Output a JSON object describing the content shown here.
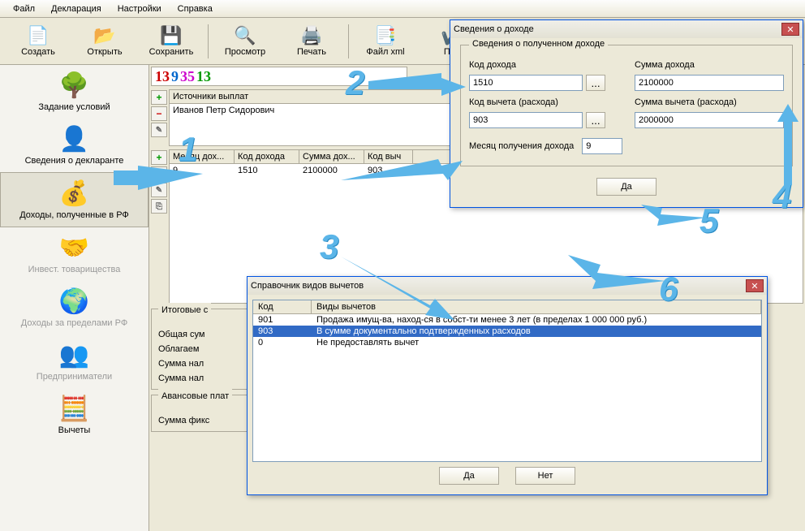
{
  "menubar": {
    "items": [
      "Файл",
      "Декларация",
      "Настройки",
      "Справка"
    ]
  },
  "toolbar": {
    "create": "Создать",
    "open": "Открыть",
    "save": "Сохранить",
    "preview": "Просмотр",
    "print": "Печать",
    "xml": "Файл xml",
    "check": "Про"
  },
  "sidebar": {
    "items": [
      {
        "label": "Задание условий"
      },
      {
        "label": "Сведения о декларанте"
      },
      {
        "label": "Доходы, полученные в РФ"
      },
      {
        "label": "Инвест. товарищества"
      },
      {
        "label": "Доходы за пределами РФ"
      },
      {
        "label": "Предприниматели"
      },
      {
        "label": "Вычеты"
      }
    ]
  },
  "numstrip": {
    "a": "13",
    "b": "9",
    "c": "35",
    "d": "13"
  },
  "sources": {
    "header": "Источники выплат",
    "row": "Иванов Петр Сидорович"
  },
  "grid": {
    "h_month": "Месяц дох...",
    "h_code": "Код дохода",
    "h_sum": "Сумма дох...",
    "h_deduct": "Код выч",
    "r_month": "9",
    "r_code": "1510",
    "r_sum": "2100000",
    "r_deduct": "903"
  },
  "summary": {
    "title": "Итоговые с",
    "line1": "Общая сум",
    "line2": "Облагаем",
    "line3": "Сумма нал",
    "line4": "Сумма нал"
  },
  "advance": {
    "title": "Авансовые плат",
    "line1": "Сумма фикс"
  },
  "dlg_income": {
    "title": "Сведения о доходе",
    "group": "Сведения о полученном доходе",
    "l_code": "Код дохода",
    "l_sum": "Сумма дохода",
    "v_code": "1510",
    "v_sum": "2100000",
    "l_dcode": "Код вычета (расхода)",
    "l_dsum": "Сумма вычета (расхода)",
    "v_dcode": "903",
    "v_dsum": "2000000",
    "l_month": "Месяц получения дохода",
    "v_month": "9",
    "ok": "Да",
    "dots": "..."
  },
  "dlg_ref": {
    "title": "Справочник видов вычетов",
    "h_code": "Код",
    "h_name": "Виды вычетов",
    "rows": [
      {
        "code": "901",
        "name": "Продажа имущ-ва, наход-ся в собст-ти менее 3 лет (в пределах 1 000 000 руб.)"
      },
      {
        "code": "903",
        "name": "В сумме документально подтвержденных расходов"
      },
      {
        "code": "0",
        "name": "Не предоставлять вычет"
      }
    ],
    "ok": "Да",
    "no": "Нет"
  },
  "ann": {
    "n1": "1",
    "n2": "2",
    "n3": "3",
    "n4": "4",
    "n5": "5",
    "n6": "6"
  }
}
